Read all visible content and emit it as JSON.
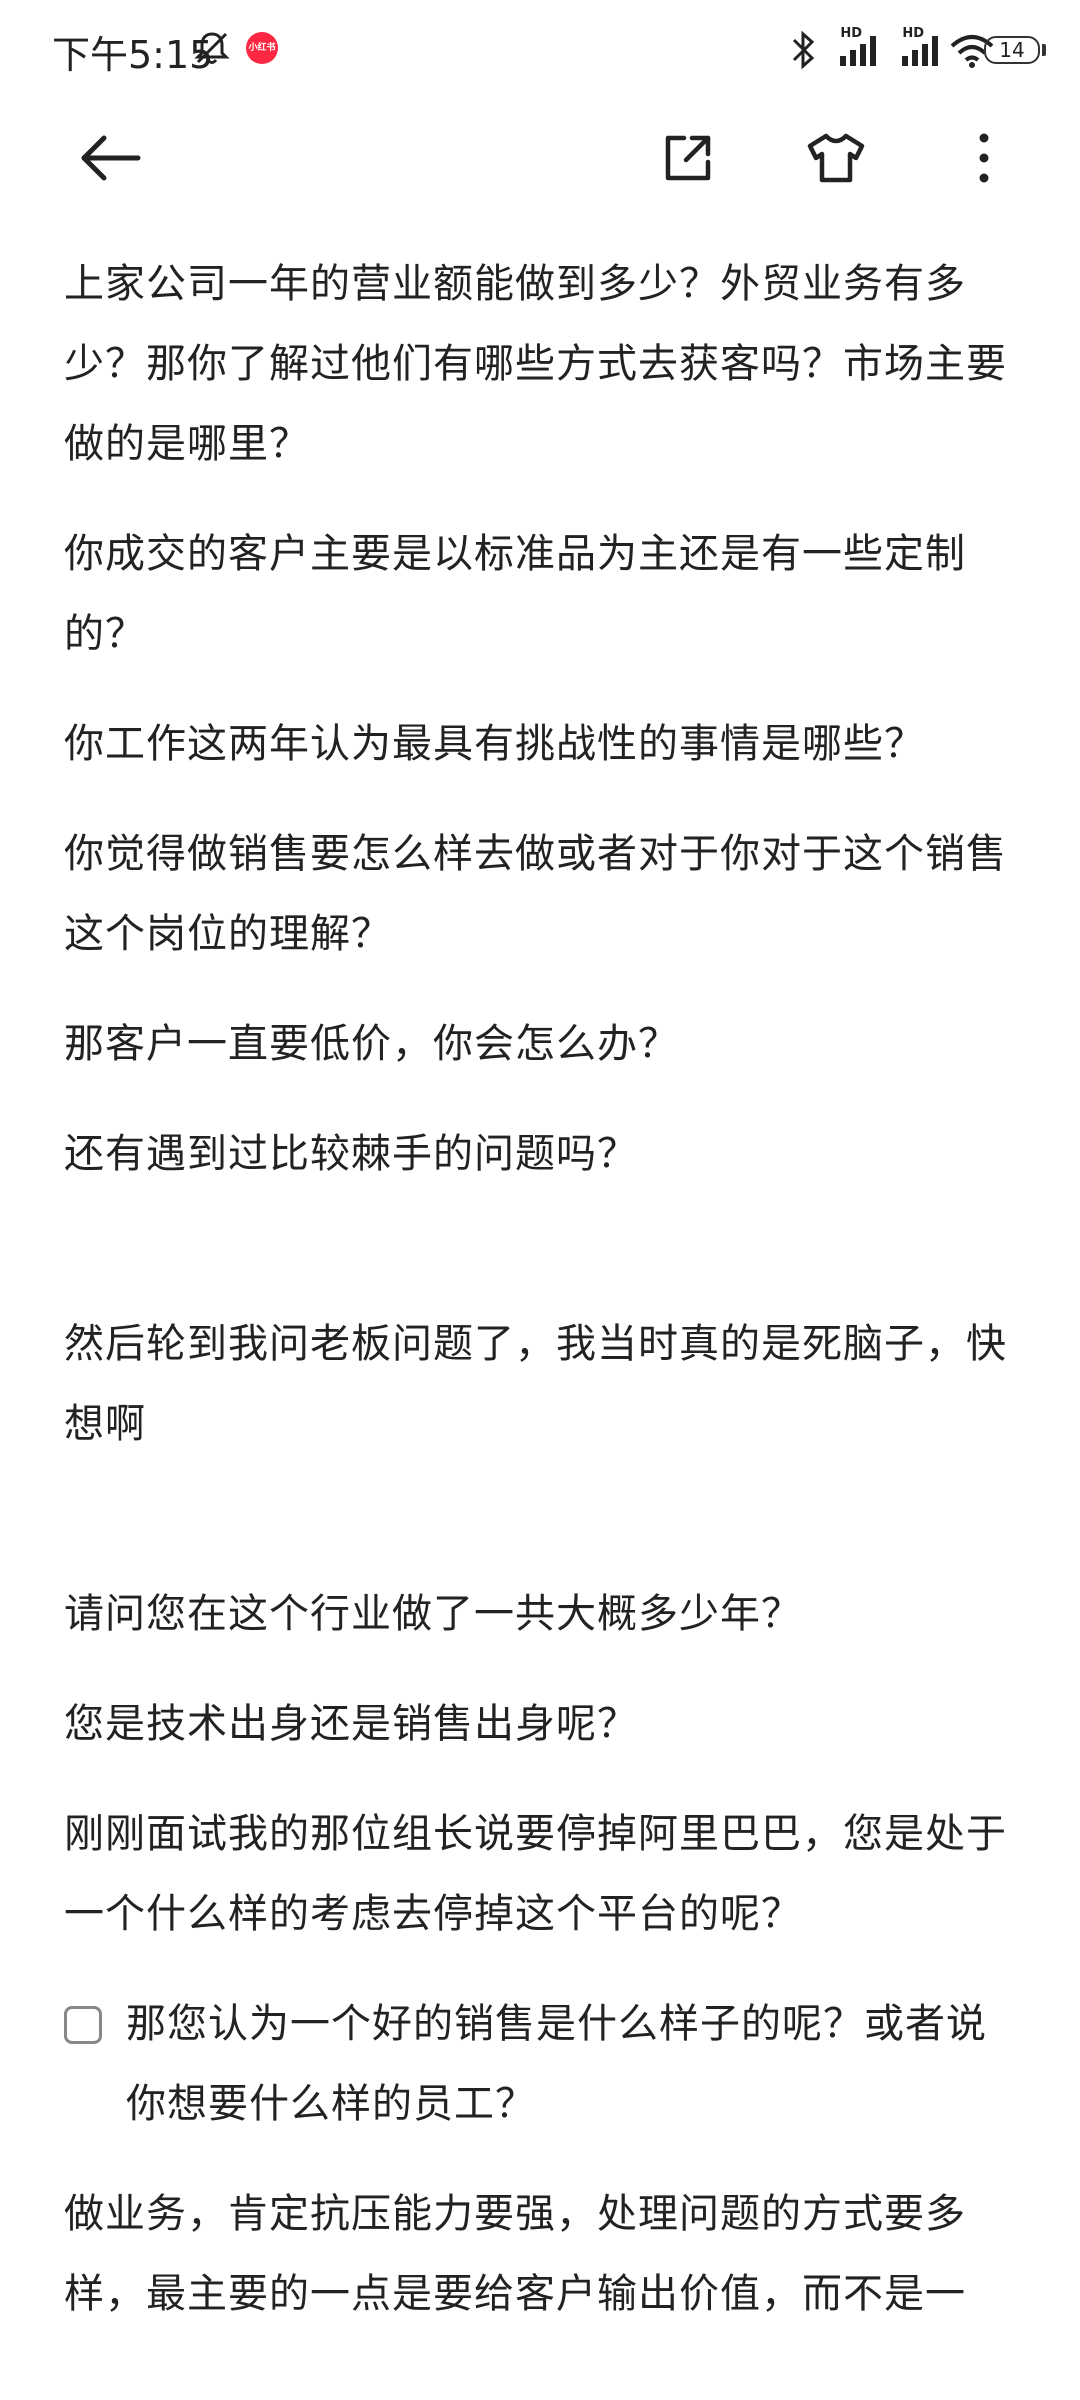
{
  "status_bar": {
    "time": "下午5:15",
    "app_badge": "小红书",
    "hd1": "HD",
    "hd2": "HD",
    "battery": "14",
    "icons": [
      "bell-muted-icon",
      "bluetooth-icon",
      "signal-icon",
      "signal-icon",
      "wifi-icon",
      "battery-icon"
    ]
  },
  "toolbar": {
    "icons": [
      "back-arrow-icon",
      "share-icon",
      "shirt-icon",
      "more-vertical-icon"
    ]
  },
  "content": {
    "paragraphs_top": [
      "上家公司一年的营业额能做到多少？外贸业务有多少？那你了解过他们有哪些方式去获客吗？市场主要做的是哪里？",
      "你成交的客户主要是以标准品为主还是有一些定制的？",
      "你工作这两年认为最具有挑战性的事情是哪些？",
      "你觉得做销售要怎么样去做或者对于你对于这个销售这个岗位的理解？",
      "那客户一直要低价，你会怎么办？",
      "还有遇到过比较棘手的问题吗？"
    ],
    "paragraph_mid": "然后轮到我问老板问题了，我当时真的是死脑子，快想啊",
    "paragraphs_bottom": [
      "请问您在这个行业做了一共大概多少年？",
      "您是技术出身还是销售出身呢？",
      "刚刚面试我的那位组长说要停掉阿里巴巴，您是处于一个什么样的考虑去停掉这个平台的呢？"
    ],
    "todo_item": "那您认为一个好的销售是什么样子的呢？或者说你想要什么样的员工？",
    "paragraph_last": "做业务，肯定抗压能力要强，处理问题的方式要多样，最主要的一点是要给客户输出价值，而不是一"
  }
}
